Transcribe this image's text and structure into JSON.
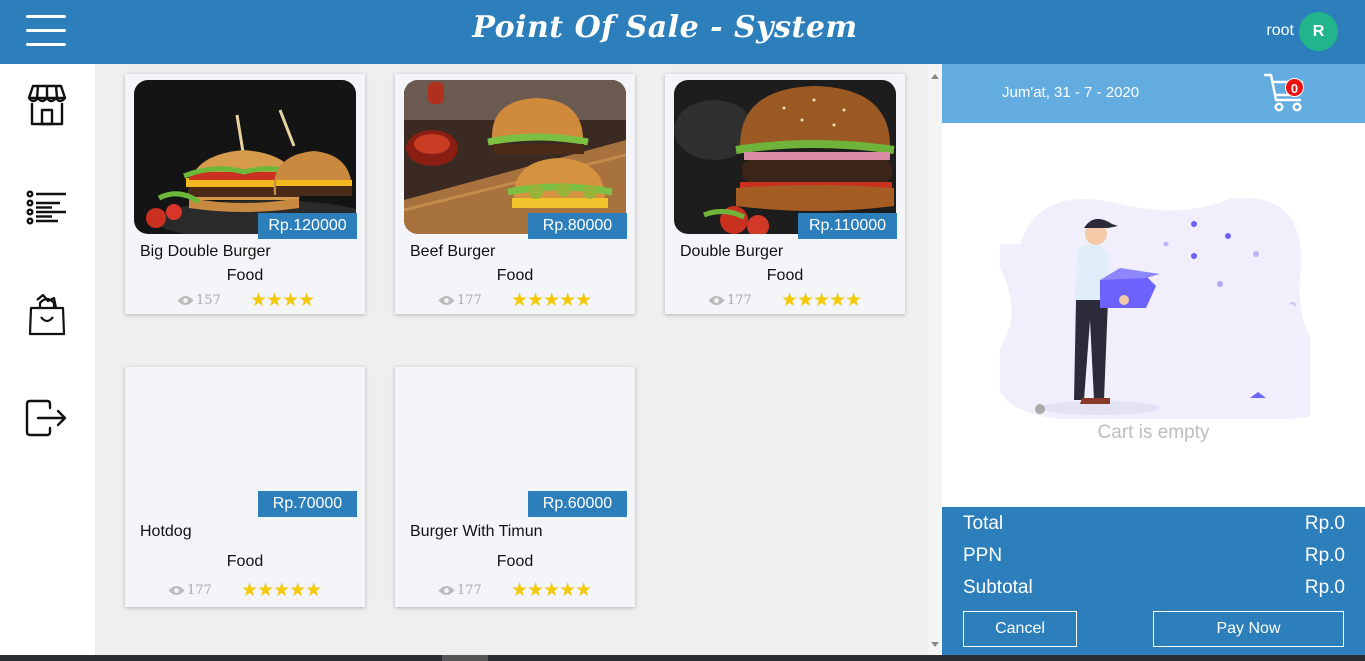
{
  "header": {
    "title": "Point Of Sale - System",
    "user_name": "root",
    "avatar_initial": "R"
  },
  "sidebar": {
    "items": [
      {
        "icon": "store-icon"
      },
      {
        "icon": "list-icon"
      },
      {
        "icon": "shopping-bag-icon"
      },
      {
        "icon": "logout-icon"
      }
    ]
  },
  "products": [
    {
      "name": "Big Double Burger",
      "price": "Rp.120000",
      "category": "Food",
      "views": "157",
      "stars": "★★★★"
    },
    {
      "name": "Beef Burger",
      "price": "Rp.80000",
      "category": "Food",
      "views": "177",
      "stars": "★★★★★"
    },
    {
      "name": "Double Burger",
      "price": "Rp.110000",
      "category": "Food",
      "views": "177",
      "stars": "★★★★★"
    },
    {
      "name": "Hotdog",
      "price": "Rp.70000",
      "category": "Food",
      "views": "177",
      "stars": "★★★★★"
    },
    {
      "name": "Burger With Timun",
      "price": "Rp.60000",
      "category": "Food",
      "views": "177",
      "stars": "★★★★★"
    }
  ],
  "cart": {
    "date": "Jum'at, 31 - 7 - 2020",
    "count": "0",
    "empty_text": "Cart is empty",
    "total_label": "Total",
    "total_value": "Rp.0",
    "ppn_label": "PPN",
    "ppn_value": "Rp.0",
    "subtotal_label": "Subtotal",
    "subtotal_value": "Rp.0",
    "cancel_label": "Cancel",
    "pay_label": "Pay Now"
  },
  "colors": {
    "primary": "#2c7fbb",
    "panel_header": "#63ace0",
    "avatar": "#22b58c",
    "star": "#f2c90b",
    "badge": "#e11111"
  }
}
